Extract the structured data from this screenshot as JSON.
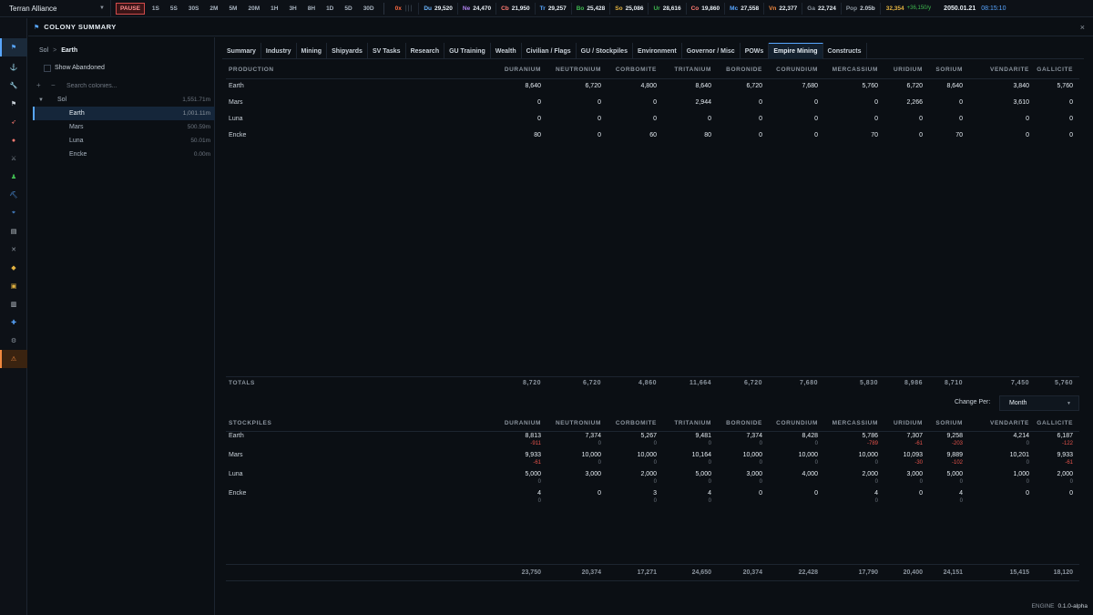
{
  "topbar": {
    "faction": "Terran Alliance",
    "pause": "PAUSE",
    "speeds": [
      "1S",
      "5S",
      "30S",
      "2M",
      "5M",
      "20M",
      "1H",
      "3H",
      "8H",
      "1D",
      "5D",
      "30D"
    ],
    "zero": "0x",
    "resources": [
      {
        "abbr": "Du",
        "value": "29,520",
        "color": "#6cb6ff"
      },
      {
        "abbr": "Ne",
        "value": "24,470",
        "color": "#b083f0"
      },
      {
        "abbr": "Cb",
        "value": "21,950",
        "color": "#ff7b72"
      },
      {
        "abbr": "Tr",
        "value": "29,257",
        "color": "#58a6ff"
      },
      {
        "abbr": "Bo",
        "value": "25,428",
        "color": "#3fb950"
      },
      {
        "abbr": "So",
        "value": "25,086",
        "color": "#e3b341"
      },
      {
        "abbr": "Ur",
        "value": "28,616",
        "color": "#3fb950"
      },
      {
        "abbr": "Co",
        "value": "19,860",
        "color": "#ff7b72"
      },
      {
        "abbr": "Mc",
        "value": "27,558",
        "color": "#58a6ff"
      },
      {
        "abbr": "Vn",
        "value": "22,377",
        "color": "#f0883e"
      },
      {
        "abbr": "Ga",
        "value": "22,724",
        "color": "#8b949e"
      }
    ],
    "pop_abbr": "Pop",
    "pop_value": "2.05b",
    "wealth": "32,354",
    "wealth_delta": "+36,150/y",
    "date": "2050.01.21",
    "time": "08:15:10"
  },
  "window": {
    "title": "COLONY SUMMARY",
    "close": "×"
  },
  "left": {
    "crumb_root": "Sol",
    "crumb_sep": ">",
    "crumb_current": "Earth",
    "show_abandoned": "Show Abandoned",
    "add": "+",
    "remove": "−",
    "search_placeholder": "Search colonies...",
    "system": {
      "name": "Sol",
      "pop": "1,551.71m",
      "arrow": "▼"
    },
    "colonies": [
      {
        "name": "Earth",
        "pop": "1,001.11m"
      },
      {
        "name": "Mars",
        "pop": "500.59m"
      },
      {
        "name": "Luna",
        "pop": "50.01m"
      },
      {
        "name": "Encke",
        "pop": "0.00m"
      }
    ]
  },
  "tabs": [
    "Summary",
    "Industry",
    "Mining",
    "Shipyards",
    "SV Tasks",
    "Research",
    "GU Training",
    "Wealth",
    "Civilian / Flags",
    "GU / Stockpiles",
    "Environment",
    "Governor / Misc",
    "POWs",
    "Empire Mining",
    "Constructs"
  ],
  "active_tab": "Empire Mining",
  "minerals": [
    "DURANIUM",
    "NEUTRONIUM",
    "CORBOMITE",
    "TRITANIUM",
    "BORONIDE",
    "CORUNDIUM",
    "MERCASSIUM",
    "URIDIUM",
    "SORIUM",
    "VENDARITE",
    "GALLICITE"
  ],
  "production": {
    "header": "PRODUCTION",
    "rows": [
      {
        "name": "Earth",
        "values": [
          "8,640",
          "6,720",
          "4,800",
          "8,640",
          "6,720",
          "7,680",
          "5,760",
          "6,720",
          "8,640",
          "3,840",
          "5,760"
        ]
      },
      {
        "name": "Mars",
        "values": [
          "0",
          "0",
          "0",
          "2,944",
          "0",
          "0",
          "0",
          "2,266",
          "0",
          "3,610",
          "0"
        ]
      },
      {
        "name": "Luna",
        "values": [
          "0",
          "0",
          "0",
          "0",
          "0",
          "0",
          "0",
          "0",
          "0",
          "0",
          "0"
        ]
      },
      {
        "name": "Encke",
        "values": [
          "80",
          "0",
          "60",
          "80",
          "0",
          "0",
          "70",
          "0",
          "70",
          "0",
          "0"
        ]
      }
    ],
    "totals_label": "TOTALS",
    "totals": [
      "8,720",
      "6,720",
      "4,860",
      "11,664",
      "6,720",
      "7,680",
      "5,830",
      "8,986",
      "8,710",
      "7,450",
      "5,760"
    ]
  },
  "change_per": {
    "label": "Change Per:",
    "value": "Month",
    "caret": "▼"
  },
  "stockpiles": {
    "header": "STOCKPILES",
    "rows": [
      {
        "name": "Earth",
        "values": [
          "8,813",
          "7,374",
          "5,267",
          "9,481",
          "7,374",
          "8,428",
          "5,786",
          "7,307",
          "9,258",
          "4,214",
          "6,187"
        ],
        "deltas": [
          "-911",
          "0",
          "0",
          "0",
          "0",
          "0",
          "-789",
          "-61",
          "-203",
          "0",
          "-122"
        ]
      },
      {
        "name": "Mars",
        "values": [
          "9,933",
          "10,000",
          "10,000",
          "10,164",
          "10,000",
          "10,000",
          "10,000",
          "10,093",
          "9,889",
          "10,201",
          "9,933"
        ],
        "deltas": [
          "-61",
          "0",
          "0",
          "0",
          "0",
          "0",
          "0",
          "-30",
          "-102",
          "0",
          "-61"
        ]
      },
      {
        "name": "Luna",
        "values": [
          "5,000",
          "3,000",
          "2,000",
          "5,000",
          "3,000",
          "4,000",
          "2,000",
          "3,000",
          "5,000",
          "1,000",
          "2,000"
        ],
        "deltas": [
          "0",
          "",
          "0",
          "0",
          "0",
          "",
          "0",
          "0",
          "0",
          "0",
          "0"
        ]
      },
      {
        "name": "Encke",
        "values": [
          "4",
          "0",
          "3",
          "4",
          "0",
          "0",
          "4",
          "0",
          "4",
          "0",
          "0"
        ],
        "deltas": [
          "0",
          "",
          "0",
          "0",
          "",
          "",
          "0",
          "",
          "0",
          "",
          ""
        ]
      }
    ],
    "totals": [
      "23,750",
      "20,374",
      "17,271",
      "24,650",
      "20,374",
      "22,428",
      "17,790",
      "20,400",
      "24,151",
      "15,415",
      "18,120"
    ]
  },
  "engine": {
    "label": "ENGINE",
    "version": "0.1.0-alpha"
  },
  "colors": {
    "accent": "#58a6ff",
    "warning": "#f0883e",
    "negative": "#e5534b",
    "pause": "#d14b4b",
    "wealth": "#e3b341"
  },
  "sidebar_icons": [
    "flag-icon",
    "anchor-icon",
    "wrench-icon",
    "flag-small-icon",
    "rocket-icon",
    "globe-icon",
    "swords-icon",
    "person-icon",
    "pickaxe-icon",
    "telescope-icon",
    "clipboard-icon",
    "crossed-swords-icon",
    "tag-icon",
    "box-icon",
    "list-icon",
    "tools-icon",
    "gear-icon",
    "warning-icon"
  ]
}
